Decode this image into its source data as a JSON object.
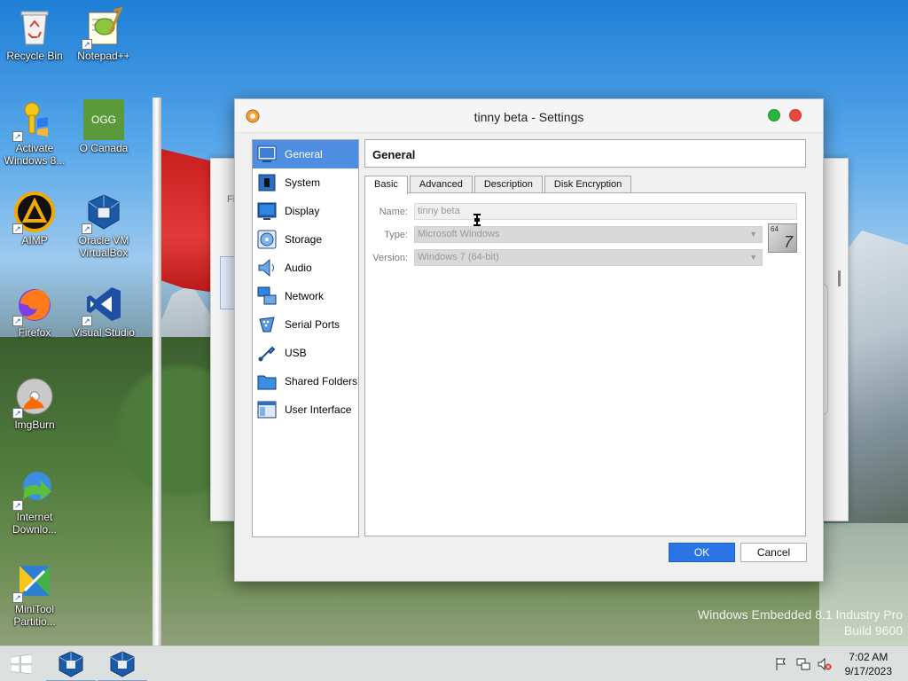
{
  "desktop": {
    "icons": [
      {
        "label": "Recycle Bin",
        "icon": "recycle-bin-icon"
      },
      {
        "label": "Notepad++",
        "icon": "notepad-plus-plus-icon"
      },
      {
        "label": "Activate Windows 8...",
        "icon": "activate-windows-icon"
      },
      {
        "label": "O Canada",
        "icon": "ogg-file-icon",
        "badge": "OGG"
      },
      {
        "label": "AIMP",
        "icon": "aimp-icon"
      },
      {
        "label": "Oracle VM VirtualBox",
        "icon": "virtualbox-icon"
      },
      {
        "label": "Firefox",
        "icon": "firefox-icon"
      },
      {
        "label": "Visual Studio",
        "icon": "visual-studio-icon"
      },
      {
        "label": "ImgBurn",
        "icon": "imgburn-icon"
      },
      {
        "label": "Internet Downlo...",
        "icon": "internet-download-manager-icon"
      },
      {
        "label": "MiniTool Partitio...",
        "icon": "minitool-partition-icon"
      }
    ],
    "watermark": {
      "line1": "Windows Embedded 8.1 Industry Pro",
      "line2": "Build 9600"
    }
  },
  "background_window": {
    "title_fragment": "Fi"
  },
  "dialog": {
    "title": "tinny beta - Settings",
    "nav": [
      {
        "label": "General",
        "icon": "general-icon",
        "active": true
      },
      {
        "label": "System",
        "icon": "system-chip-icon"
      },
      {
        "label": "Display",
        "icon": "display-monitor-icon"
      },
      {
        "label": "Storage",
        "icon": "storage-disk-icon"
      },
      {
        "label": "Audio",
        "icon": "audio-speaker-icon"
      },
      {
        "label": "Network",
        "icon": "network-icon"
      },
      {
        "label": "Serial Ports",
        "icon": "serial-port-icon"
      },
      {
        "label": "USB",
        "icon": "usb-icon"
      },
      {
        "label": "Shared Folders",
        "icon": "shared-folder-icon"
      },
      {
        "label": "User Interface",
        "icon": "user-interface-icon"
      }
    ],
    "page_title": "General",
    "tabs": [
      {
        "label": "Basic",
        "active": true
      },
      {
        "label": "Advanced"
      },
      {
        "label": "Description"
      },
      {
        "label": "Disk Encryption"
      }
    ],
    "fields": {
      "name_label": "Name:",
      "name_value": "tinny beta",
      "type_label": "Type:",
      "type_value": "Microsoft Windows",
      "version_label": "Version:",
      "version_value": "Windows 7 (64-bit)"
    },
    "os_badge": {
      "arch": "64",
      "version": "7"
    },
    "buttons": {
      "ok": "OK",
      "cancel": "Cancel"
    }
  },
  "taskbar": {
    "apps": [
      {
        "name": "virtualbox-taskbar-1",
        "running": true
      },
      {
        "name": "virtualbox-taskbar-2",
        "running": true
      }
    ],
    "clock": {
      "time": "7:02 AM",
      "date": "9/17/2023"
    }
  }
}
